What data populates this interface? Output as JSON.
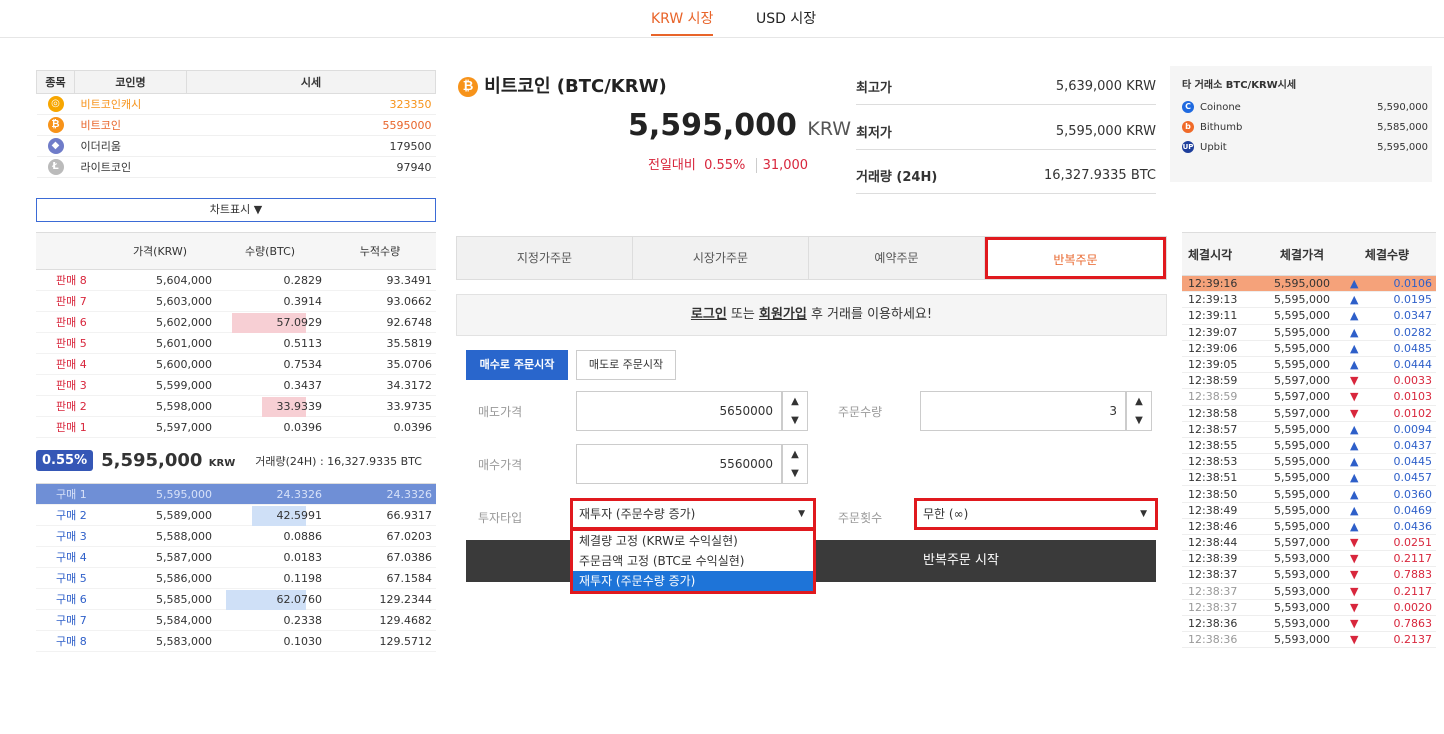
{
  "market_tabs": {
    "krw": "KRW 시장",
    "usd": "USD 시장"
  },
  "coin_table": {
    "headers": [
      "종목",
      "코인명",
      "시세"
    ],
    "rows": [
      {
        "name": "비트코인캐시",
        "price": "323350",
        "icon": "bitcoin-cash-icon",
        "color": "#f7931a"
      },
      {
        "name": "비트코인",
        "price": "5595000",
        "icon": "bitcoin-icon",
        "color": "#e8642a"
      },
      {
        "name": "이더리움",
        "price": "179500",
        "icon": "ethereum-icon",
        "color": "#333333"
      },
      {
        "name": "라이트코인",
        "price": "97940",
        "icon": "litecoin-icon",
        "color": "#333333"
      }
    ],
    "chart_toggle": "차트표시 ▼"
  },
  "orderbook": {
    "headers": [
      "가격(KRW)",
      "수량(BTC)",
      "누적수량"
    ],
    "sells": [
      {
        "label": "판매 8",
        "price": "5,604,000",
        "qty": "0.2829",
        "cum": "93.3491",
        "bar": 0
      },
      {
        "label": "판매 7",
        "price": "5,603,000",
        "qty": "0.3914",
        "cum": "93.0662",
        "bar": 0
      },
      {
        "label": "판매 6",
        "price": "5,602,000",
        "qty": "57.0929",
        "cum": "92.6748",
        "bar": 0.92
      },
      {
        "label": "판매 5",
        "price": "5,601,000",
        "qty": "0.5113",
        "cum": "35.5819",
        "bar": 0
      },
      {
        "label": "판매 4",
        "price": "5,600,000",
        "qty": "0.7534",
        "cum": "35.0706",
        "bar": 0
      },
      {
        "label": "판매 3",
        "price": "5,599,000",
        "qty": "0.3437",
        "cum": "34.3172",
        "bar": 0
      },
      {
        "label": "판매 2",
        "price": "5,598,000",
        "qty": "33.9339",
        "cum": "33.9735",
        "bar": 0.55
      },
      {
        "label": "판매 1",
        "price": "5,597,000",
        "qty": "0.0396",
        "cum": "0.0396",
        "bar": 0
      }
    ],
    "mid": {
      "pct": "0.55%",
      "price": "5,595,000",
      "unit": "KRW",
      "volume": "거래량(24H) : 16,327.9335 BTC"
    },
    "buys": [
      {
        "label": "구매 1",
        "price": "5,595,000",
        "qty": "24.3326",
        "cum": "24.3326",
        "bar": 0
      },
      {
        "label": "구매 2",
        "price": "5,589,000",
        "qty": "42.5991",
        "cum": "66.9317",
        "bar": 0.68
      },
      {
        "label": "구매 3",
        "price": "5,588,000",
        "qty": "0.0886",
        "cum": "67.0203",
        "bar": 0
      },
      {
        "label": "구매 4",
        "price": "5,587,000",
        "qty": "0.0183",
        "cum": "67.0386",
        "bar": 0
      },
      {
        "label": "구매 5",
        "price": "5,586,000",
        "qty": "0.1198",
        "cum": "67.1584",
        "bar": 0
      },
      {
        "label": "구매 6",
        "price": "5,585,000",
        "qty": "62.0760",
        "cum": "129.2344",
        "bar": 1.0
      },
      {
        "label": "구매 7",
        "price": "5,584,000",
        "qty": "0.2338",
        "cum": "129.4682",
        "bar": 0
      },
      {
        "label": "구매 8",
        "price": "5,583,000",
        "qty": "0.1030",
        "cum": "129.5712",
        "bar": 0
      }
    ]
  },
  "header": {
    "title": "비트코인 (BTC/KRW)",
    "price": "5,595,000",
    "unit": "KRW",
    "change_label": "전일대비",
    "change_pct": "0.55%",
    "change_abs": "31,000",
    "stats": [
      {
        "label": "최고가",
        "value": "5,639,000 KRW"
      },
      {
        "label": "최저가",
        "value": "5,595,000 KRW"
      },
      {
        "label": "거래량 (24H)",
        "value": "16,327.9335 BTC"
      }
    ]
  },
  "other_exchanges": {
    "title": "타 거래소 BTC/KRW시세",
    "items": [
      {
        "name": "Coinone",
        "price": "5,590,000",
        "color": "#1f6ae0"
      },
      {
        "name": "Bithumb",
        "price": "5,585,000",
        "color": "#f06a28"
      },
      {
        "name": "Upbit",
        "price": "5,595,000",
        "color": "#1d3e9b"
      }
    ]
  },
  "order_tabs": [
    "지정가주문",
    "시장가주문",
    "예약주문",
    "반복주문"
  ],
  "login_notice": {
    "login": "로그인",
    "or": " 또는 ",
    "signup": "회원가입",
    "rest": " 후 거래를 이용하세요!"
  },
  "order_form": {
    "buy_start": "매수로 주문시작",
    "sell_start": "매도로 주문시작",
    "sell_price_label": "매도가격",
    "sell_price": "5650000",
    "qty_label": "주문수량",
    "qty": "3",
    "buy_price_label": "매수가격",
    "buy_price": "5560000",
    "invest_type_label": "투자타입",
    "invest_type": "재투자 (주문수량 증가)",
    "count_label": "주문횟수",
    "count": "무한 (∞)",
    "submit": "반복주문 시작",
    "dropdown_options": [
      "체결량 고정 (KRW로 수익실현)",
      "주문금액 고정 (BTC로 수익실현)",
      "재투자 (주문수량 증가)"
    ]
  },
  "trades": {
    "headers": [
      "체결시각",
      "체결가격",
      "체결수량"
    ],
    "rows": [
      {
        "time": "12:39:16",
        "price": "5,595,000",
        "dir": "up",
        "qty": "0.0106",
        "grey": false,
        "first": true
      },
      {
        "time": "12:39:13",
        "price": "5,595,000",
        "dir": "up",
        "qty": "0.0195",
        "grey": false
      },
      {
        "time": "12:39:11",
        "price": "5,595,000",
        "dir": "up",
        "qty": "0.0347",
        "grey": false
      },
      {
        "time": "12:39:07",
        "price": "5,595,000",
        "dir": "up",
        "qty": "0.0282",
        "grey": false
      },
      {
        "time": "12:39:06",
        "price": "5,595,000",
        "dir": "up",
        "qty": "0.0485",
        "grey": false
      },
      {
        "time": "12:39:05",
        "price": "5,595,000",
        "dir": "up",
        "qty": "0.0444",
        "grey": false
      },
      {
        "time": "12:38:59",
        "price": "5,597,000",
        "dir": "down",
        "qty": "0.0033",
        "grey": false
      },
      {
        "time": "12:38:59",
        "price": "5,597,000",
        "dir": "down",
        "qty": "0.0103",
        "grey": true
      },
      {
        "time": "12:38:58",
        "price": "5,597,000",
        "dir": "down",
        "qty": "0.0102",
        "grey": false
      },
      {
        "time": "12:38:57",
        "price": "5,595,000",
        "dir": "up",
        "qty": "0.0094",
        "grey": false
      },
      {
        "time": "12:38:55",
        "price": "5,595,000",
        "dir": "up",
        "qty": "0.0437",
        "grey": false
      },
      {
        "time": "12:38:53",
        "price": "5,595,000",
        "dir": "up",
        "qty": "0.0445",
        "grey": false
      },
      {
        "time": "12:38:51",
        "price": "5,595,000",
        "dir": "up",
        "qty": "0.0457",
        "grey": false
      },
      {
        "time": "12:38:50",
        "price": "5,595,000",
        "dir": "up",
        "qty": "0.0360",
        "grey": false
      },
      {
        "time": "12:38:49",
        "price": "5,595,000",
        "dir": "up",
        "qty": "0.0469",
        "grey": false
      },
      {
        "time": "12:38:46",
        "price": "5,595,000",
        "dir": "up",
        "qty": "0.0436",
        "grey": false
      },
      {
        "time": "12:38:44",
        "price": "5,597,000",
        "dir": "down",
        "qty": "0.0251",
        "grey": false
      },
      {
        "time": "12:38:39",
        "price": "5,593,000",
        "dir": "down",
        "qty": "0.2117",
        "grey": false
      },
      {
        "time": "12:38:37",
        "price": "5,593,000",
        "dir": "down",
        "qty": "0.7883",
        "grey": false
      },
      {
        "time": "12:38:37",
        "price": "5,593,000",
        "dir": "down",
        "qty": "0.2117",
        "grey": true
      },
      {
        "time": "12:38:37",
        "price": "5,593,000",
        "dir": "down",
        "qty": "0.0020",
        "grey": true
      },
      {
        "time": "12:38:36",
        "price": "5,593,000",
        "dir": "down",
        "qty": "0.7863",
        "grey": false
      },
      {
        "time": "12:38:36",
        "price": "5,593,000",
        "dir": "down",
        "qty": "0.2137",
        "grey": true
      }
    ]
  }
}
